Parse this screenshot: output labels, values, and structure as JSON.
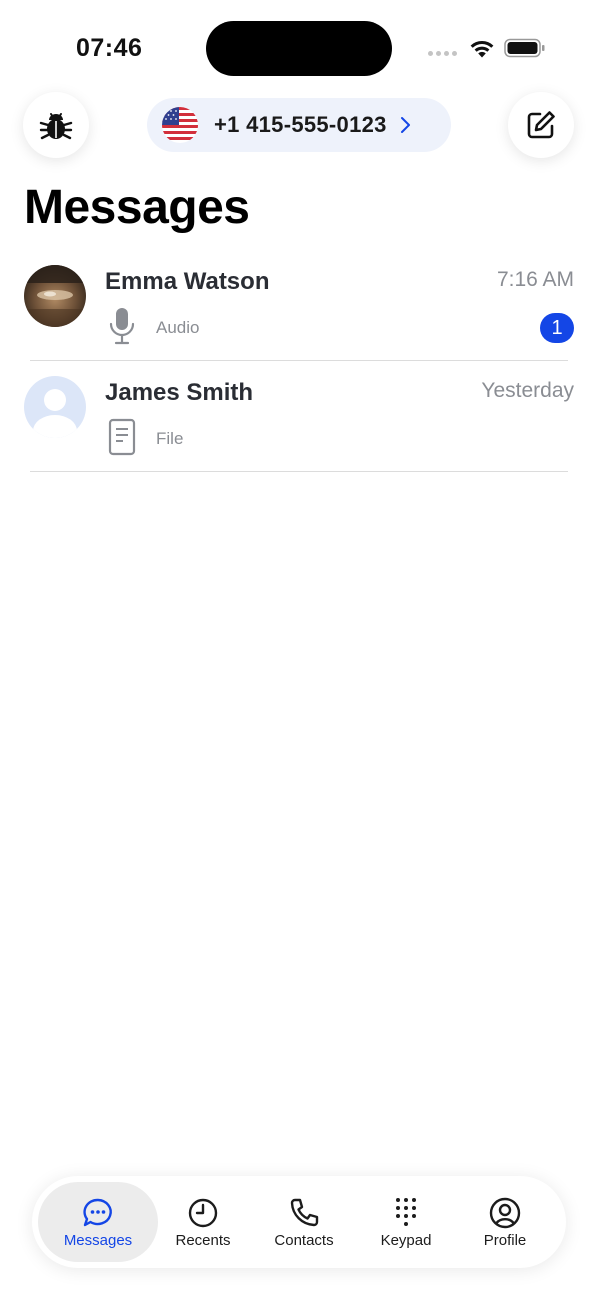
{
  "status_bar": {
    "time": "07:46"
  },
  "header": {
    "phone_number": "+1 415-555-0123",
    "flag_icon": "us-flag-icon",
    "left_icon": "bug-icon",
    "right_icon": "compose-icon"
  },
  "page_title": "Messages",
  "conversations": [
    {
      "name": "Emma Watson",
      "time": "7:16 AM",
      "type_label": "Audio",
      "type_icon": "microphone-icon",
      "unread": "1"
    },
    {
      "name": "James Smith",
      "time": "Yesterday",
      "type_label": "File",
      "type_icon": "file-icon",
      "unread": ""
    }
  ],
  "tabbar": {
    "active": "Messages",
    "tabs": [
      {
        "label": "Messages",
        "icon": "message-bubble-icon"
      },
      {
        "label": "Recents",
        "icon": "clock-icon"
      },
      {
        "label": "Contacts",
        "icon": "phone-icon"
      },
      {
        "label": "Keypad",
        "icon": "keypad-icon"
      },
      {
        "label": "Profile",
        "icon": "profile-icon"
      }
    ]
  },
  "colors": {
    "accent": "#1446e6",
    "pill_background": "#eef2fb",
    "muted_text": "#8a8d93"
  }
}
